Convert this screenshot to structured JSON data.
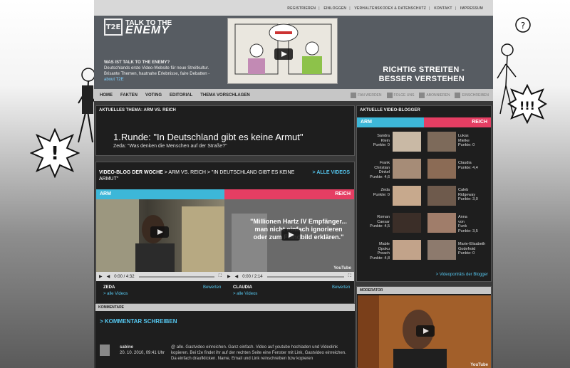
{
  "util_nav": [
    "REGISTRIEREN",
    "EINLOGGEN",
    "VERHALTENSKODEX & DATENSCHUTZ",
    "KONTAKT",
    "IMPRESSUM"
  ],
  "logo": {
    "box": "T2E",
    "line1": "TALK TO THE",
    "line2": "ENEMY"
  },
  "intro": {
    "heading": "WAS IST TALK TO THE ENEMY?",
    "text": "Deutschlands erste Video-Website für neue Streitkultur. Brisante Themen, hautnahe Erlebnisse, faire Debatten -",
    "link": "about T2E"
  },
  "slogan": {
    "line1": "RICHTIG STREITEN -",
    "line2": "BESSER VERSTEHEN"
  },
  "main_nav": [
    "HOME",
    "FAKTEN",
    "VOTING",
    "EDITORIAL",
    "THEMA VORSCHLAGEN"
  ],
  "social": [
    "FAN WERDEN",
    "FOLGE UNS",
    "ABONNIEREN",
    "EINSCHREIBEN"
  ],
  "topic": {
    "label": "AKTUELLES THEMA: ARM VS. REICH",
    "headline": "1.Runde: \"In Deutschland gibt es keine Armut\"",
    "subline": "Zeda: \"Was denken die Menschen auf der Straße?\""
  },
  "videoblog": {
    "title_bold": "VIDEO-BLOG DER WOCHE",
    "title_rest": " > ARM VS. REICH > \"IN DEUTSCHLAND GIBT ES KEINE ARMUT\"",
    "all_videos": "> ALLE VIDEOS",
    "arm": "ARM",
    "reich": "REICH",
    "left": {
      "time": "0:00 / 4:32",
      "name": "ZEDA",
      "rate": "Bewerten",
      "all": "> alle Videos"
    },
    "right": {
      "time": "0:00 / 2:14",
      "name": "CLAUDIA",
      "rate": "Bewerten",
      "all": "> alle Videos",
      "overlay": "\"Millionen Hartz IV Empfänger... man nicht einfach ignorieren oder zum Feindbild erklären.\""
    },
    "youtube": "YouTube"
  },
  "comments": {
    "label": "KOMMENTARE",
    "write": "> KOMMENTAR SCHREIBEN",
    "author": "sabine",
    "date": "20. 10. 2010, 09:41 Uhr",
    "text": "@ alle. Gastvideo einreichen. Ganz einfach. Video auf youtube hochladen und Videolink kopieren. Bei t2e findet ihr auf der rechten Seite eine Fenster mit Link, Gastvideo einreichen. Da einfach draufklicken. Name, Email und Link reinschreiben bzw kopieren"
  },
  "bloggers": {
    "label": "AKTUELLE VIDEO-BLOGGER",
    "arm": "ARM",
    "reich": "REICH",
    "rows": [
      {
        "left": [
          "Sandra",
          "Klein",
          "Punkte: 0"
        ],
        "right": [
          "Lukas",
          "Mielke",
          "Punkte: 0"
        ]
      },
      {
        "left": [
          "Frank",
          "Christian",
          "Dinkel",
          "Punkte: 4,6"
        ],
        "right": [
          "Claudia",
          "Punkte: 4,4"
        ]
      },
      {
        "left": [
          "Zeda",
          "Punkte: 0"
        ],
        "right": [
          "Caleb",
          "Ridgeway",
          "Punkte: 3,0"
        ]
      },
      {
        "left": [
          "Roman",
          "Caesar",
          "Punkte: 4,5"
        ],
        "right": [
          "Anna",
          "von",
          "Funk",
          "Punkte: 3,5"
        ]
      },
      {
        "left": [
          "Mable",
          "Opoku",
          "Preach",
          "Punkte: 4,8"
        ],
        "right": [
          "Marie-Elisabeth",
          "Godefroid",
          "Punkte: 0"
        ]
      }
    ],
    "portraits": "> Videoporträts der Blogger"
  },
  "moderator": {
    "label": "MODERATOR",
    "youtube": "YouTube"
  }
}
